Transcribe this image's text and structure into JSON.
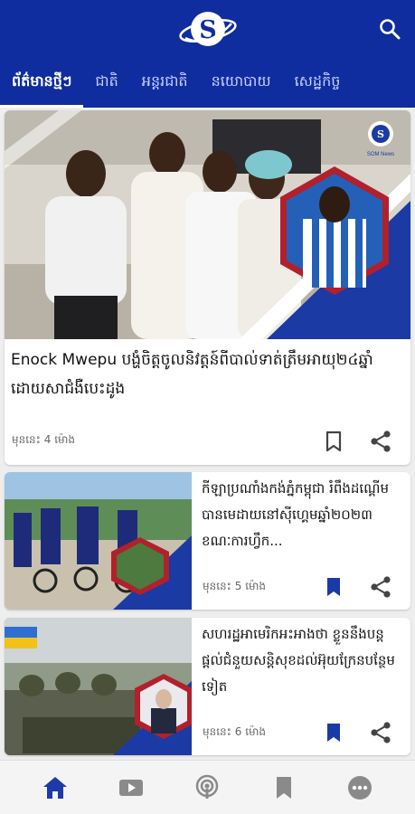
{
  "header": {
    "logo_icon": "som-news-logo",
    "search_icon": "search-icon"
  },
  "tabs": [
    {
      "label": "ព័ត៌មានថ្មីៗ",
      "active": true
    },
    {
      "label": "ជាតិ",
      "active": false
    },
    {
      "label": "អន្តរជាតិ",
      "active": false
    },
    {
      "label": "នយោបាយ",
      "active": false
    },
    {
      "label": "សេដ្ឋកិច្ច",
      "active": false
    }
  ],
  "hero": {
    "title": "Enock Mwepu បង្ហំចិត្តចូលនិវត្តន៍ពីបាល់ទាត់ត្រឹមអាយុ២៤ឆ្នាំ ដោយសាជំងឺបេះដូង",
    "time": "មុននេះ 4 ម៉ោង",
    "badge": "SOM News",
    "bookmarked": false
  },
  "articles": [
    {
      "title": "កីឡាប្រណាំងកង់ភ្នំកម្ពុជា រំពឹងដណ្ដើមបានមេដាយនៅស៊ីហ្គេមឆ្នាំ២០២៣ ខណៈការហ្វឹក...",
      "time": "មុននេះ 5 ម៉ោង",
      "bookmarked": true
    },
    {
      "title": "សហរដ្ឋអាមេរិកអះអាងថា ខ្លួននឹងបន្តផ្តល់ជំនួយសន្តិសុខដល់អ៊ុយក្រែនបន្ថែមទៀត",
      "time": "មុននេះ 6 ម៉ោង",
      "bookmarked": true
    }
  ],
  "nav": {
    "items": [
      "home-icon",
      "video-icon",
      "podcast-icon",
      "bookmark-icon",
      "more-icon"
    ],
    "active_index": 0
  },
  "colors": {
    "brand": "#0f2d9e",
    "nav_active": "#1f3aa8",
    "nav_inactive": "#8a8a8a",
    "bookmark_filled": "#1a3aa8"
  }
}
